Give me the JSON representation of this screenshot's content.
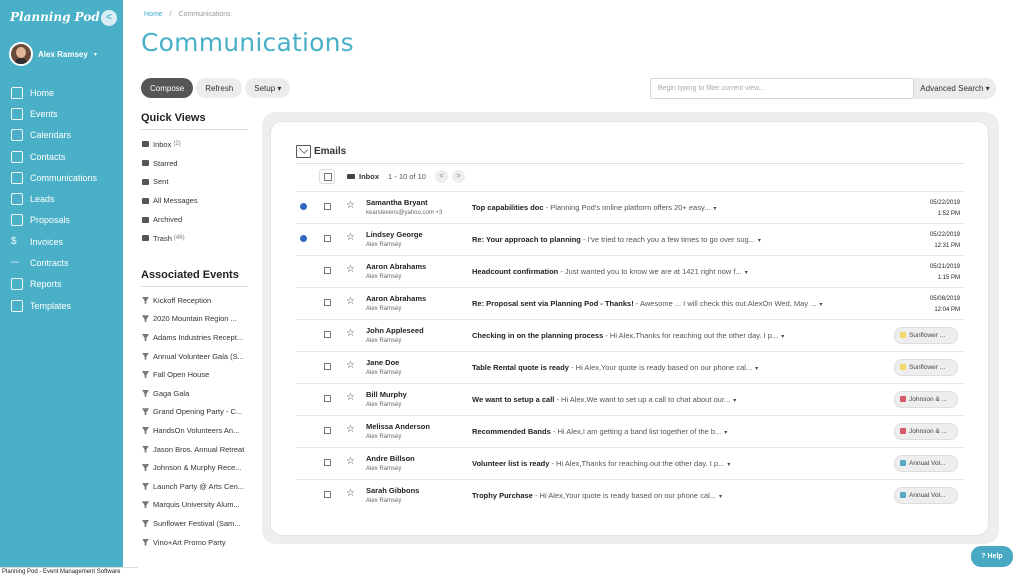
{
  "app": {
    "logo": "Planning Pod",
    "collapse_icon": "chevron-left-icon"
  },
  "user": {
    "name": "Alex Ramsey",
    "caret": "▾"
  },
  "nav": [
    {
      "label": "Home",
      "icon": "home-icon"
    },
    {
      "label": "Events",
      "icon": "events-icon"
    },
    {
      "label": "Calendars",
      "icon": "calendar-icon"
    },
    {
      "label": "Contacts",
      "icon": "contacts-icon"
    },
    {
      "label": "Communications",
      "icon": "communications-icon"
    },
    {
      "label": "Leads",
      "icon": "leads-icon"
    },
    {
      "label": "Proposals",
      "icon": "proposals-icon"
    },
    {
      "label": "Invoices",
      "icon": "invoice-icon"
    },
    {
      "label": "Contracts",
      "icon": "contracts-icon"
    },
    {
      "label": "Reports",
      "icon": "reports-icon"
    },
    {
      "label": "Templates",
      "icon": "templates-icon"
    }
  ],
  "footer": "Planning Pod - Event Management Software",
  "breadcrumb": {
    "home": "Home",
    "separator": "/",
    "current": "Communications"
  },
  "page_title": "Communications",
  "toolbar": {
    "compose": "Compose",
    "refresh": "Refresh",
    "setup": "Setup ▾"
  },
  "search": {
    "placeholder": "Begin typing to filter current view...",
    "advanced": "Advanced Search ▾"
  },
  "quick_views": {
    "title": "Quick Views",
    "items": [
      {
        "label": "Inbox",
        "count": "(2)",
        "icon": "inbox-icon"
      },
      {
        "label": "Starred",
        "count": "",
        "icon": "star-icon"
      },
      {
        "label": "Sent",
        "count": "",
        "icon": "send-icon"
      },
      {
        "label": "All Messages",
        "count": "",
        "icon": "messages-icon"
      },
      {
        "label": "Archived",
        "count": "",
        "icon": "archive-icon"
      },
      {
        "label": "Trash",
        "count": "(46)",
        "icon": "trash-icon"
      }
    ]
  },
  "associated_events": {
    "title": "Associated Events",
    "items": [
      "Kickoff Reception",
      "2020 Mountain Region ...",
      "Adams Industries Recept...",
      "Annual Volunteer Gala (S...",
      "Fall Open House",
      "Gaga Gala",
      "Grand Opening Party - C...",
      "HandsOn Volunteers An...",
      "Jason Bros. Annual Retreat",
      "Johnson & Murphy Rece...",
      "Launch Party @ Arts Cen...",
      "Marquis University Alum...",
      "Sunflower Festival (Sam...",
      "Vino+Art Promo Party"
    ]
  },
  "emails": {
    "title": "Emails",
    "inbox_label": "Inbox",
    "range": "1 - 10 of 10",
    "prev": "<",
    "next": ">",
    "rows": [
      {
        "unread": true,
        "sender": "Samantha Bryant",
        "sub": "kearstevens@yahoo.com +3",
        "subject": "Top capabilities doc",
        "preview": " - Planning Pod's online platform offers 20+ easy...",
        "date": "05/22/2019",
        "time": "1:52 PM",
        "tag": "",
        "tag_color": ""
      },
      {
        "unread": true,
        "sender": "Lindsey George",
        "sub": "Alex Ramsey",
        "subject": "Re: Your approach to planning",
        "preview": " - I've tried to reach you a few times to go over sug...",
        "date": "05/22/2019",
        "time": "12:31 PM",
        "tag": "",
        "tag_color": ""
      },
      {
        "unread": false,
        "sender": "Aaron Abrahams",
        "sub": "Alex Ramsey",
        "subject": "Headcount confirmation",
        "preview": " - Just wanted you to know we are at 1421 right now f...",
        "date": "05/21/2019",
        "time": "1:15 PM",
        "tag": "",
        "tag_color": ""
      },
      {
        "unread": false,
        "sender": "Aaron Abrahams",
        "sub": "Alex Ramsey",
        "subject": "Re: Proposal sent via Planning Pod - Thanks!",
        "preview": " - Awesome ... I will check this out.AlexOn Wed, May ...",
        "date": "05/08/2019",
        "time": "12:04 PM",
        "tag": "",
        "tag_color": ""
      },
      {
        "unread": false,
        "sender": "John Appleseed",
        "sub": "Alex Ramsey",
        "subject": "Checking in on the planning process",
        "preview": " - Hi Alex,Thanks for reaching out the other day. I p...",
        "date": "",
        "time": "",
        "tag": "Sunflower ...",
        "tag_color": "#f3d86a"
      },
      {
        "unread": false,
        "sender": "Jane Doe",
        "sub": "Alex Ramsey",
        "subject": "Table Rental quote is ready",
        "preview": " - Hi Alex,Your quote is ready based on our phone cal...",
        "date": "",
        "time": "",
        "tag": "Sunflower ...",
        "tag_color": "#f3d86a"
      },
      {
        "unread": false,
        "sender": "Bill Murphy",
        "sub": "Alex Ramsey",
        "subject": "We want to setup a call",
        "preview": " - Hi Alex,We want to set up a call to chat about our...",
        "date": "",
        "time": "",
        "tag": "Johnson & ...",
        "tag_color": "#d65a6b"
      },
      {
        "unread": false,
        "sender": "Melissa Anderson",
        "sub": "Alex Ramsey",
        "subject": "Recommended Bands",
        "preview": " - Hi Alex,I am getting a band list together of the b...",
        "date": "",
        "time": "",
        "tag": "Johnson & ...",
        "tag_color": "#d65a6b"
      },
      {
        "unread": false,
        "sender": "Andre Billson",
        "sub": "Alex Ramsey",
        "subject": "Volunteer list is ready",
        "preview": " - Hi Alex,Thanks for reaching out the other day. I p...",
        "date": "",
        "time": "",
        "tag": "Annual Vol...",
        "tag_color": "#57a8c7"
      },
      {
        "unread": false,
        "sender": "Sarah Gibbons",
        "sub": "Alex Ramsey",
        "subject": "Trophy Purchase",
        "preview": " - Hi Alex,Your quote is ready based on our phone cal...",
        "date": "",
        "time": "",
        "tag": "Annual Vol...",
        "tag_color": "#57a8c7"
      }
    ]
  },
  "help": "? Help",
  "colors": {
    "sidebar": "#4ab0c8",
    "accent": "#4ab0c8",
    "unread_dot": "#3268c4"
  }
}
